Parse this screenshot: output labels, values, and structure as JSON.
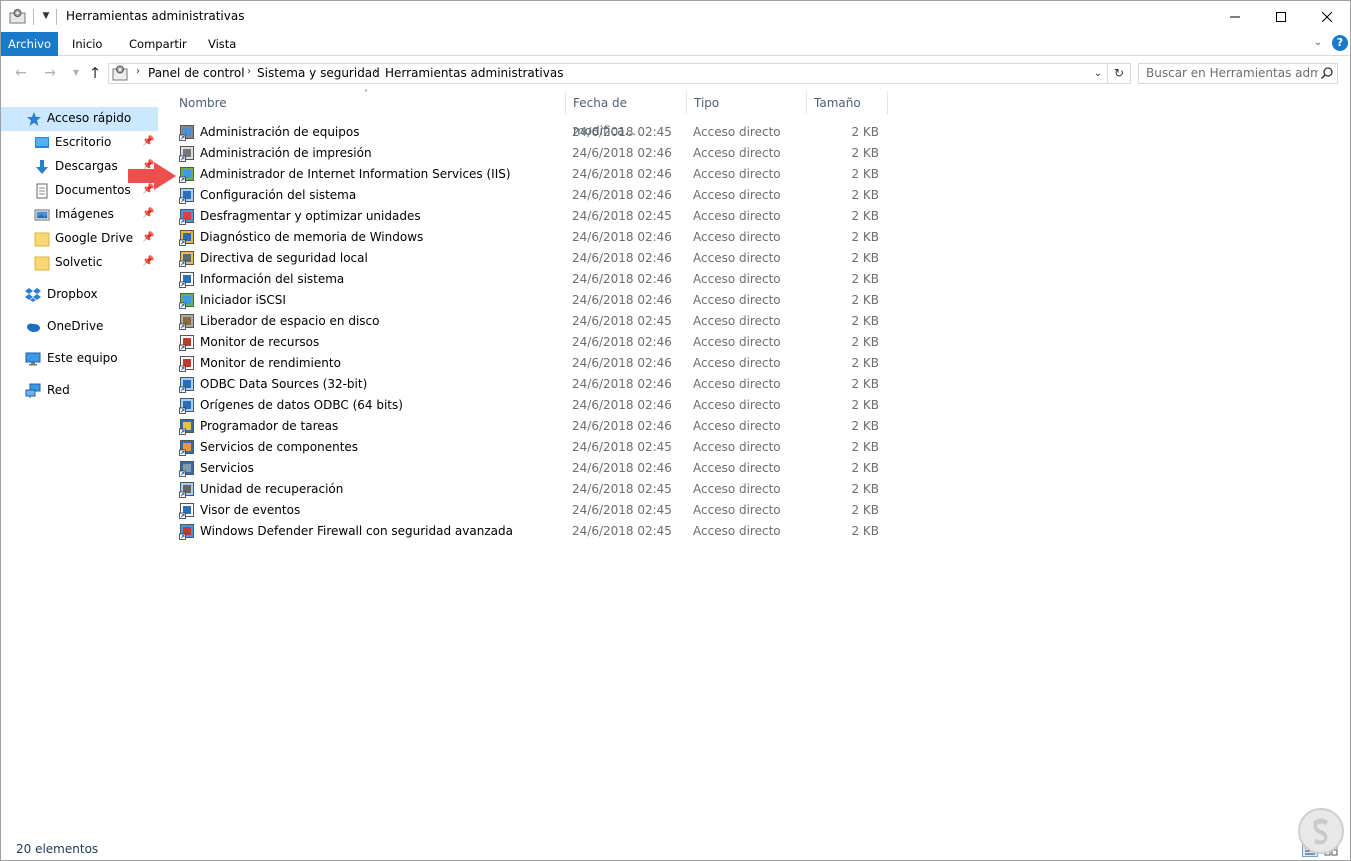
{
  "window": {
    "title": "Herramientas administrativas"
  },
  "ribbon": {
    "tabs": [
      {
        "label": "Archivo",
        "active": true
      },
      {
        "label": "Inicio"
      },
      {
        "label": "Compartir"
      },
      {
        "label": "Vista"
      }
    ],
    "help_label": "?"
  },
  "address": {
    "breadcrumbs": [
      "Panel de control",
      "Sistema y seguridad",
      "Herramientas administrativas"
    ],
    "search_placeholder": "Buscar en Herramientas admi..."
  },
  "nav": {
    "items": [
      {
        "label": "Acceso rápido",
        "icon": "star-icon",
        "selected": true,
        "pinned": false
      },
      {
        "label": "Escritorio",
        "icon": "desktop-folder-icon",
        "pinned": true
      },
      {
        "label": "Descargas",
        "icon": "download-arrow-icon",
        "pinned": true
      },
      {
        "label": "Documentos",
        "icon": "documents-icon",
        "pinned": true
      },
      {
        "label": "Imágenes",
        "icon": "pictures-icon",
        "pinned": true
      },
      {
        "label": "Google Drive",
        "icon": "folder-icon",
        "pinned": true
      },
      {
        "label": "Solvetic",
        "icon": "folder-icon",
        "pinned": true
      },
      {
        "label": "Dropbox",
        "icon": "dropbox-icon"
      },
      {
        "label": "OneDrive",
        "icon": "onedrive-cloud-icon"
      },
      {
        "label": "Este equipo",
        "icon": "computer-icon"
      },
      {
        "label": "Red",
        "icon": "network-icon"
      }
    ]
  },
  "columns": {
    "name": "Nombre",
    "date": "Fecha de modifica...",
    "type": "Tipo",
    "size": "Tamaño"
  },
  "files": [
    {
      "name": "Administración de equipos",
      "date": "24/6/2018 02:45",
      "type": "Acceso directo",
      "size": "2 KB",
      "icon": "computer-management-icon"
    },
    {
      "name": "Administración de impresión",
      "date": "24/6/2018 02:46",
      "type": "Acceso directo",
      "size": "2 KB",
      "icon": "printer-icon"
    },
    {
      "name": "Administrador de Internet Information Services (IIS)",
      "date": "24/6/2018 02:46",
      "type": "Acceso directo",
      "size": "2 KB",
      "icon": "iis-icon"
    },
    {
      "name": "Configuración del sistema",
      "date": "24/6/2018 02:46",
      "type": "Acceso directo",
      "size": "2 KB",
      "icon": "system-config-icon"
    },
    {
      "name": "Desfragmentar y optimizar unidades",
      "date": "24/6/2018 02:45",
      "type": "Acceso directo",
      "size": "2 KB",
      "icon": "defrag-icon"
    },
    {
      "name": "Diagnóstico de memoria de Windows",
      "date": "24/6/2018 02:46",
      "type": "Acceso directo",
      "size": "2 KB",
      "icon": "memory-diagnostic-icon"
    },
    {
      "name": "Directiva de seguridad local",
      "date": "24/6/2018 02:46",
      "type": "Acceso directo",
      "size": "2 KB",
      "icon": "security-policy-icon"
    },
    {
      "name": "Información del sistema",
      "date": "24/6/2018 02:46",
      "type": "Acceso directo",
      "size": "2 KB",
      "icon": "system-info-icon"
    },
    {
      "name": "Iniciador iSCSI",
      "date": "24/6/2018 02:46",
      "type": "Acceso directo",
      "size": "2 KB",
      "icon": "iscsi-globe-icon"
    },
    {
      "name": "Liberador de espacio en disco",
      "date": "24/6/2018 02:45",
      "type": "Acceso directo",
      "size": "2 KB",
      "icon": "disk-cleanup-icon"
    },
    {
      "name": "Monitor de recursos",
      "date": "24/6/2018 02:46",
      "type": "Acceso directo",
      "size": "2 KB",
      "icon": "resource-monitor-icon"
    },
    {
      "name": "Monitor de rendimiento",
      "date": "24/6/2018 02:46",
      "type": "Acceso directo",
      "size": "2 KB",
      "icon": "performance-monitor-icon"
    },
    {
      "name": "ODBC Data Sources (32-bit)",
      "date": "24/6/2018 02:46",
      "type": "Acceso directo",
      "size": "2 KB",
      "icon": "odbc-icon"
    },
    {
      "name": "Orígenes de datos ODBC (64 bits)",
      "date": "24/6/2018 02:46",
      "type": "Acceso directo",
      "size": "2 KB",
      "icon": "odbc-icon"
    },
    {
      "name": "Programador de tareas",
      "date": "24/6/2018 02:46",
      "type": "Acceso directo",
      "size": "2 KB",
      "icon": "task-scheduler-icon"
    },
    {
      "name": "Servicios de componentes",
      "date": "24/6/2018 02:45",
      "type": "Acceso directo",
      "size": "2 KB",
      "icon": "component-services-icon"
    },
    {
      "name": "Servicios",
      "date": "24/6/2018 02:46",
      "type": "Acceso directo",
      "size": "2 KB",
      "icon": "services-gear-icon"
    },
    {
      "name": "Unidad de recuperación",
      "date": "24/6/2018 02:45",
      "type": "Acceso directo",
      "size": "2 KB",
      "icon": "recovery-drive-icon"
    },
    {
      "name": "Visor de eventos",
      "date": "24/6/2018 02:45",
      "type": "Acceso directo",
      "size": "2 KB",
      "icon": "event-viewer-icon"
    },
    {
      "name": "Windows Defender Firewall con seguridad avanzada",
      "date": "24/6/2018 02:45",
      "type": "Acceso directo",
      "size": "2 KB",
      "icon": "firewall-icon"
    }
  ],
  "status": {
    "count": "20 elementos"
  },
  "colors": {
    "accent": "#1979ca",
    "selection": "#cce8ff",
    "annotation_arrow": "#ee4e4e"
  }
}
